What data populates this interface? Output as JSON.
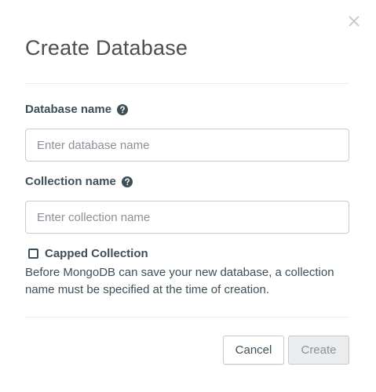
{
  "dialog": {
    "title": "Create Database",
    "close_icon": "close-icon"
  },
  "database_name": {
    "label": "Database name",
    "help_icon": "question-circle-icon",
    "placeholder": "Enter database name",
    "value": ""
  },
  "collection_name": {
    "label": "Collection name",
    "help_icon": "question-circle-icon",
    "placeholder": "Enter collection name",
    "value": ""
  },
  "capped_collection": {
    "label": "Capped Collection",
    "checked": false
  },
  "info_text": "Before MongoDB can save your new database, a collection name must be specified at the time of creation.",
  "footer": {
    "cancel_label": "Cancel",
    "create_label": "Create",
    "create_disabled": true
  },
  "colors": {
    "text": "#3d4f58",
    "title": "#4a4f54",
    "border": "#c9cccf",
    "disabled_bg": "#ebecee",
    "disabled_text": "#8c9196"
  }
}
